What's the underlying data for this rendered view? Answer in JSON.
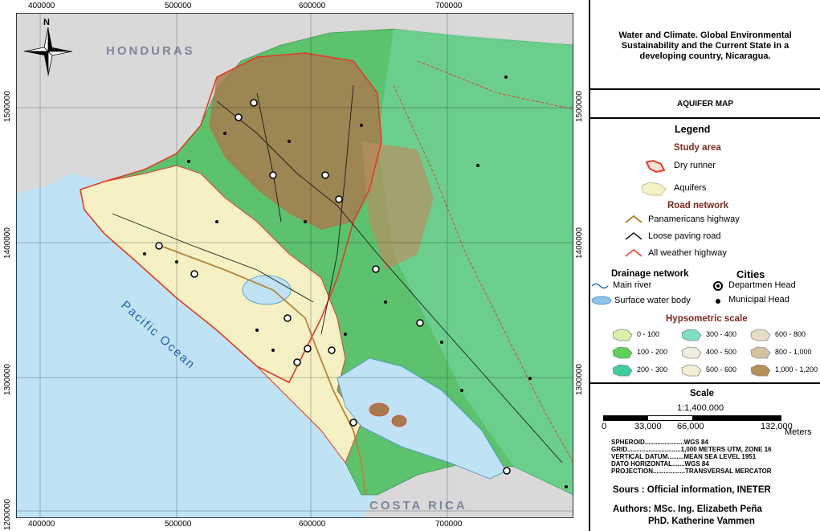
{
  "map": {
    "x_ticks": [
      "400000",
      "500000",
      "600000",
      "700000"
    ],
    "y_ticks": [
      "1500000",
      "1400000",
      "1300000",
      "1200000"
    ],
    "labels": {
      "honduras": "HONDURAS",
      "costa_rica": "COSTA RICA",
      "pacific_ocean": "Pacific Ocean",
      "north": "N"
    },
    "colors": {
      "ocean": "#bfe3f5",
      "lowland": "#5cc26e",
      "aquifer": "#f5f1c4",
      "mountain": "#a77b4f",
      "study_area": "#e23a2a",
      "neighbor": "#d9d9d9"
    }
  },
  "panel": {
    "title": "Water and Climate. Global Environmental Sustainability and the Current State in a developing country, Nicaragua.",
    "subtitle": "AQUIFER MAP",
    "legend": {
      "heading": "Legend",
      "study_area": "Study area",
      "dry_runner": "Dry runner",
      "aquifers": "Aquifers",
      "road_network": "Road network",
      "panamericans": "Panamericans highway",
      "loose_paving": "Loose paving road",
      "all_weather": "All weather highway",
      "drainage": "Drainage network",
      "main_river": "Main river",
      "surface_water": "Surface water body",
      "cities": "Cities",
      "dept_head": "Departmen Head",
      "muni_head": "Municipal Head",
      "hypsometric": "Hypsometric scale",
      "hyps_items": [
        "0 - 100",
        "300 - 400",
        "600 - 800",
        "100 - 200",
        "400 - 500",
        "800 - 1,000",
        "200 - 300",
        "500 - 600",
        "1,000 - 1,200"
      ],
      "hyps_colors": [
        "#d8f0a8",
        "#7fe0c6",
        "#e8dcc6",
        "#5ed15a",
        "#f0ece0",
        "#d6c2a0",
        "#3fcf9a",
        "#f3efd2",
        "#b69058"
      ]
    },
    "scale": {
      "heading": "Scale",
      "ratio": "1:1,400,000",
      "ticks": [
        "0",
        "33,000",
        "66,000",
        "132,000"
      ],
      "unit": "Meters"
    },
    "projection": [
      "SPHEROID......................WGS 84",
      "GRID..............................1,000 METERS UTM, ZONE 16",
      "VERTICAL DATUM.........MEAN SEA LEVEL 1951",
      "DATO HORIZONTAL.......WGS 84",
      "PROJECTION..................TRANSVERSAL MERCATOR"
    ],
    "source": "Sours : Official information, INETER",
    "authors_line1": "Authors: MSc. Ing. Elizabeth Peña",
    "authors_line2": "PhD. Katherine Vammen"
  }
}
